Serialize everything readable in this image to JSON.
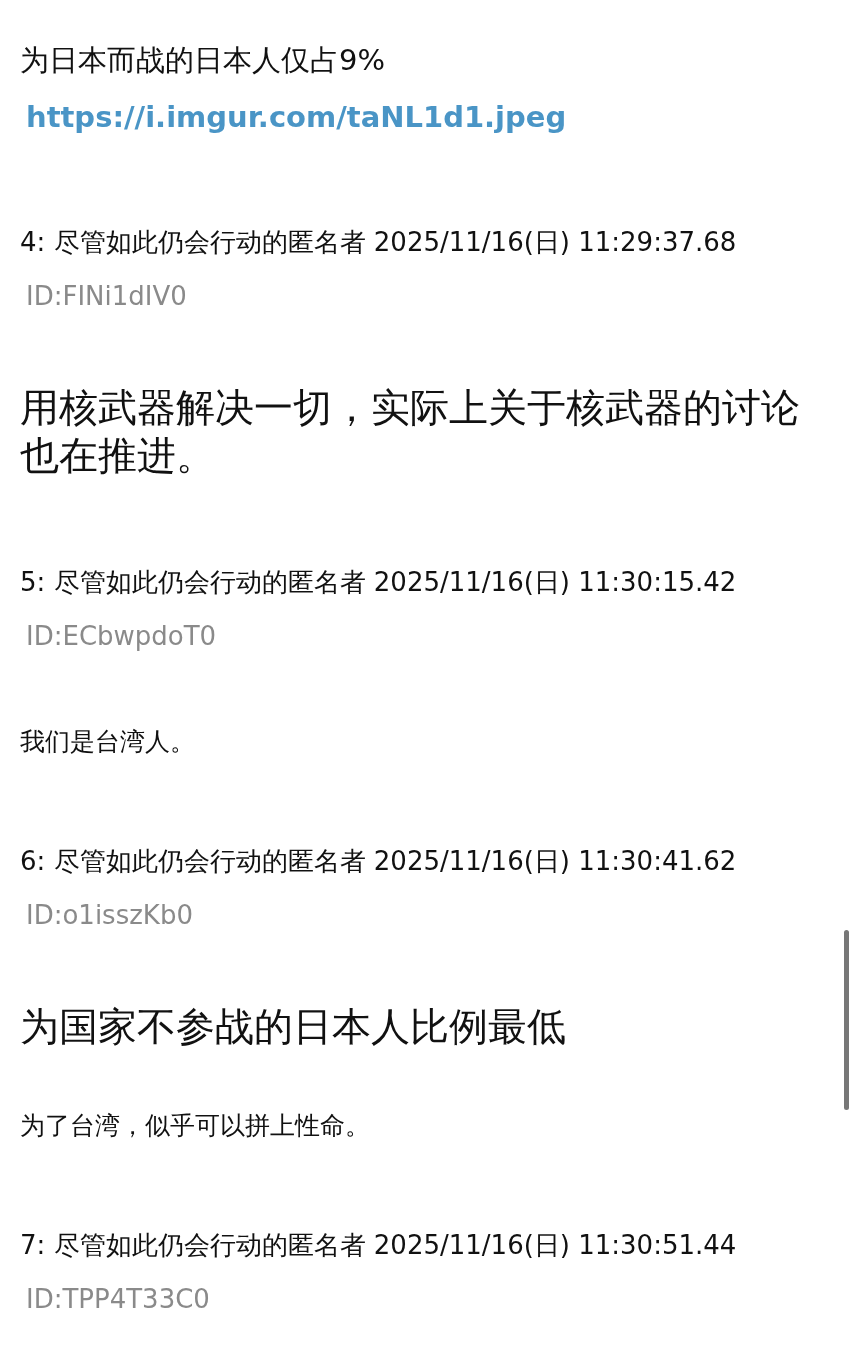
{
  "posts": [
    {
      "body": [
        {
          "kind": "text",
          "text": "为日本而战的日本人仅占9%"
        },
        {
          "kind": "link",
          "text": "https://i.imgur.com/taNL1d1.jpeg"
        }
      ]
    },
    {
      "header": "4: 尽管如此仍会行动的匿名者 2025/11/16(日) 11:29:37.68",
      "id": "ID:FINi1dIV0",
      "body": [
        {
          "kind": "headline",
          "text": "用核武器解决一切，实际上关于核武器的讨论也在推进。"
        }
      ]
    },
    {
      "header": "5: 尽管如此仍会行动的匿名者 2025/11/16(日) 11:30:15.42",
      "id": "ID:ECbwpdoT0",
      "body": [
        {
          "kind": "note",
          "text": "我们是台湾人。"
        }
      ]
    },
    {
      "header": "6: 尽管如此仍会行动的匿名者 2025/11/16(日) 11:30:41.62",
      "id": "ID:o1isszKb0",
      "body": [
        {
          "kind": "headline",
          "text": "为国家不参战的日本人比例最低"
        },
        {
          "kind": "note",
          "text": "为了台湾，似乎可以拼上性命。"
        }
      ]
    },
    {
      "header": "7: 尽管如此仍会行动的匿名者 2025/11/16(日) 11:30:51.44",
      "id": "ID:TPP4T33C0"
    }
  ]
}
